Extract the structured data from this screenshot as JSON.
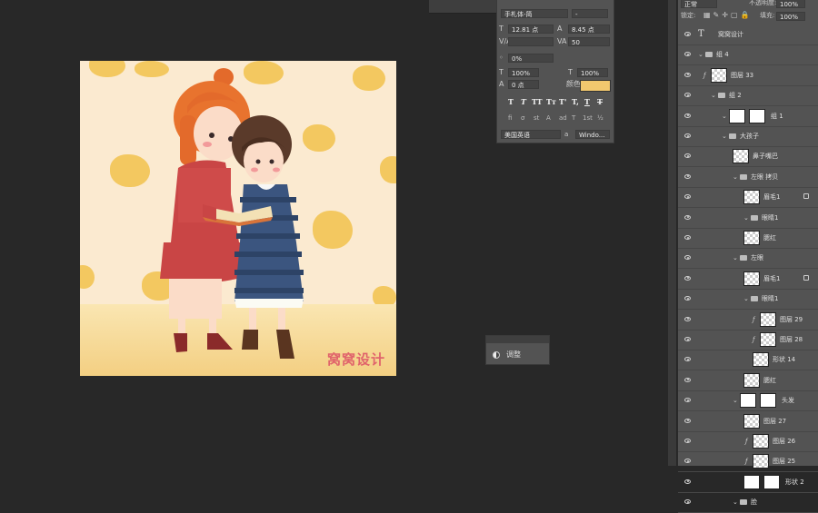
{
  "character_panel": {
    "font_family": "手札体-简",
    "font_style": "-",
    "font_size": "12.81 点",
    "leading": "8.45 点",
    "kerning": "",
    "tracking": "50",
    "scale_label": "0%",
    "vertical_scale": "100%",
    "horizontal_scale": "100%",
    "baseline_shift": "0 点",
    "color_label": "颜色:",
    "color": "#f2c86e",
    "language": "美国英语",
    "antialias": "Windo...",
    "style_buttons": [
      "T",
      "T",
      "TT",
      "Tт",
      "T'",
      "T,",
      "T",
      "T"
    ],
    "opentype_buttons": [
      "fi",
      "σ",
      "st",
      "A",
      "ad",
      "T",
      "1st",
      "½"
    ]
  },
  "adjustments_panel": {
    "label": "调整"
  },
  "artwork": {
    "brand_text": "窝窝设计"
  },
  "layers_panel": {
    "blend_mode": "正常",
    "opacity_label": "不透明度:",
    "opacity": "100%",
    "lock_label": "锁定:",
    "fill_label": "填充:",
    "fill": "100%",
    "layers": [
      {
        "name": "窝窝设计",
        "type": "text"
      },
      {
        "name": "组 4",
        "type": "group"
      },
      {
        "name": "图层 33",
        "type": "layer"
      },
      {
        "name": "组 2",
        "type": "group"
      },
      {
        "name": "组 1",
        "type": "group"
      },
      {
        "name": "大孩子",
        "type": "group"
      },
      {
        "name": "鼻子嘴巴",
        "type": "layer"
      },
      {
        "name": "左眼 拷贝",
        "type": "group"
      },
      {
        "name": "眉毛1",
        "type": "layer"
      },
      {
        "name": "眼睛1",
        "type": "group"
      },
      {
        "name": "腮红",
        "type": "layer"
      },
      {
        "name": "左眼",
        "type": "group"
      },
      {
        "name": "眉毛1",
        "type": "layer"
      },
      {
        "name": "眼睛1",
        "type": "group"
      },
      {
        "name": "图层 29",
        "type": "layer"
      },
      {
        "name": "图层 28",
        "type": "layer"
      },
      {
        "name": "形状 14",
        "type": "layer"
      },
      {
        "name": "腮红",
        "type": "layer"
      },
      {
        "name": "头发",
        "type": "group"
      },
      {
        "name": "图层 27",
        "type": "layer"
      },
      {
        "name": "图层 26",
        "type": "layer"
      },
      {
        "name": "图层 25",
        "type": "layer"
      },
      {
        "name": "形状 2",
        "type": "layer"
      },
      {
        "name": "脸",
        "type": "group"
      }
    ]
  }
}
